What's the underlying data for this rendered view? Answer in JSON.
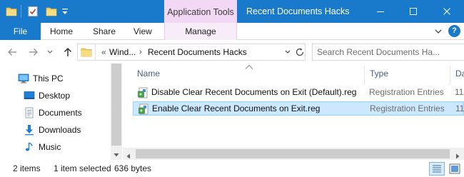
{
  "window": {
    "title": "Recent Documents Hacks",
    "context_tab_group": "Application Tools",
    "accent_color": "#1979ca",
    "context_color": "#f2d8f4"
  },
  "ribbon": {
    "tabs": [
      {
        "label": "File"
      },
      {
        "label": "Home"
      },
      {
        "label": "Share"
      },
      {
        "label": "View"
      },
      {
        "label": "Manage"
      }
    ],
    "help_label": "?"
  },
  "address": {
    "overflow": "«",
    "crumbs": [
      "Wind...",
      "Recent Documents Hacks"
    ],
    "chevron": "›"
  },
  "search": {
    "placeholder": "Search Recent Documents Ha..."
  },
  "nav_pane": {
    "items": [
      {
        "label": "This PC",
        "icon": "computer-icon"
      },
      {
        "label": "Desktop",
        "icon": "desktop-icon"
      },
      {
        "label": "Documents",
        "icon": "documents-icon"
      },
      {
        "label": "Downloads",
        "icon": "downloads-icon"
      },
      {
        "label": "Music",
        "icon": "music-icon"
      }
    ]
  },
  "file_list": {
    "columns": [
      "Name",
      "Type",
      "Da"
    ],
    "rows": [
      {
        "name": "Disable Clear Recent Documents on Exit (Default).reg",
        "type": "Registration Entries",
        "date": "11",
        "selected": false
      },
      {
        "name": "Enable Clear Recent Documents on Exit.reg",
        "type": "Registration Entries",
        "date": "11",
        "selected": true
      }
    ]
  },
  "status": {
    "item_count": "2 items",
    "selected": "1 item selected",
    "size": "636 bytes"
  }
}
